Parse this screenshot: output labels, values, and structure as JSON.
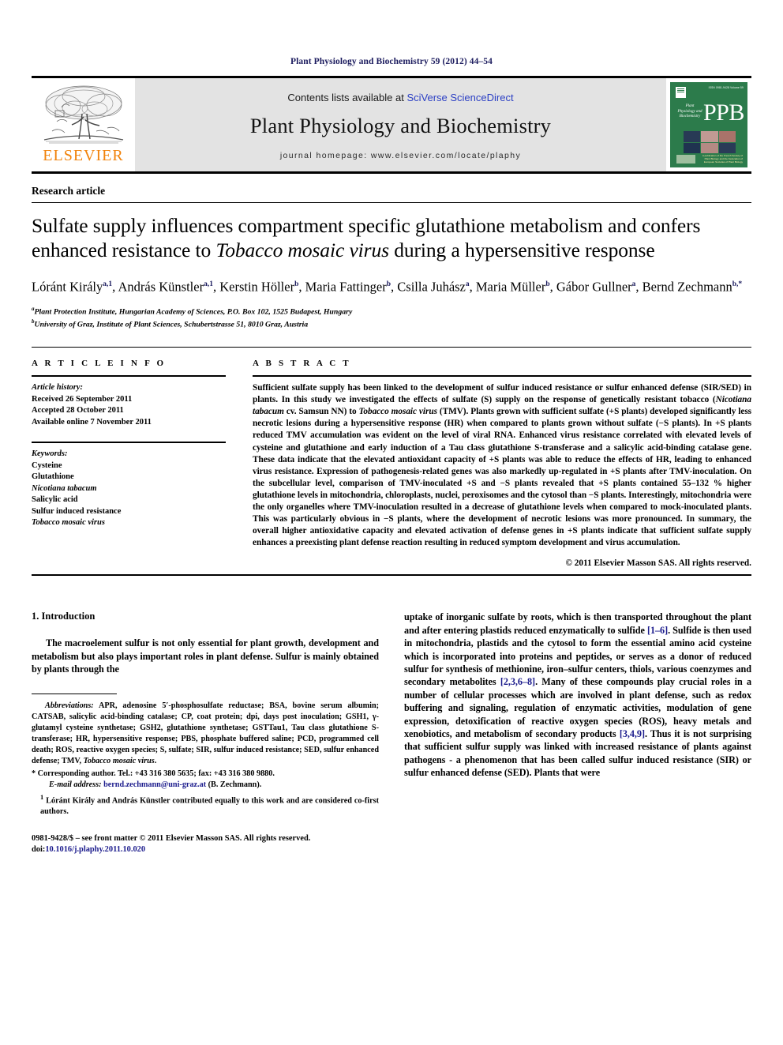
{
  "running_head": "Plant Physiology and Biochemistry 59 (2012) 44–54",
  "banner": {
    "publisher_name": "ELSEVIER",
    "contents_prefix": "Contents lists available at ",
    "contents_link": "SciVerse ScienceDirect",
    "journal_title": "Plant Physiology and Biochemistry",
    "homepage": "journal homepage: www.elsevier.com/locate/plaphy",
    "cover": {
      "mark": "PPB",
      "sub": "Plant Physiology and Biochemistry",
      "issn": "ISSN 0981-9428 Volume 59",
      "footer": "A publication of the French Society of Plant Biology and the Federation of European Societies of Plant Biology"
    },
    "accent_orange": "#f1820a",
    "link_blue": "#2b3fc4",
    "cover_green": "#2c7b4b"
  },
  "article_type": "Research article",
  "title": {
    "part1": "Sulfate supply influences compartment specific glutathione metabolism and confers enhanced resistance to ",
    "italic": "Tobacco mosaic virus",
    "part2": " during a hypersensitive response"
  },
  "authors_line1": "Lóránt Király",
  "authors_html": "Lóránt Király a,1, András Künstler a,1, Kerstin Höller b, Maria Fattinger b, Csilla Juhász a, Maria Müller b, Gábor Gullner a, Bernd Zechmann b,*",
  "affiliations": [
    {
      "mark": "a",
      "text": "Plant Protection Institute, Hungarian Academy of Sciences, P.O. Box 102, 1525 Budapest, Hungary"
    },
    {
      "mark": "b",
      "text": "University of Graz, Institute of Plant Sciences, Schubertstrasse 51, 8010 Graz, Austria"
    }
  ],
  "article_info": {
    "heading": "A R T I C L E    I N F O",
    "history_label": "Article history:",
    "history": [
      "Received 26 September 2011",
      "Accepted 28 October 2011",
      "Available online 7 November 2011"
    ],
    "keywords_label": "Keywords:",
    "keywords": [
      {
        "text": "Cysteine",
        "italic": false
      },
      {
        "text": "Glutathione",
        "italic": false
      },
      {
        "text": "Nicotiana tabacum",
        "italic": true
      },
      {
        "text": "Salicylic acid",
        "italic": false
      },
      {
        "text": "Sulfur induced resistance",
        "italic": false
      },
      {
        "text": "Tobacco mosaic virus",
        "italic": true
      }
    ]
  },
  "abstract": {
    "heading": "A B S T R A C T",
    "copyright": "© 2011 Elsevier Masson SAS. All rights reserved."
  },
  "introduction": {
    "heading": "1. Introduction",
    "left_para": "The macroelement sulfur is not only essential for plant growth, development and metabolism but also plays important roles in plant defense. Sulfur is mainly obtained by plants through the"
  },
  "footnotes": {
    "abbrev_label": "Abbreviations:",
    "abbrev_text": " APR, adenosine 5′-phosphosulfate reductase; BSA, bovine serum albumin; CATSAB, salicylic acid-binding catalase; CP, coat protein; dpi, days post inoculation; GSH1, γ-glutamyl cysteine synthetase; GSH2, glutathione synthetase; GSTTau1, Tau class glutathione S-transferase; HR, hypersensitive response; PBS, phosphate buffered saline; PCD, programmed cell death; ROS, reactive oxygen species; S, sulfate; SIR, sulfur induced resistance; SED, sulfur enhanced defense; TMV, ",
    "abbrev_italic_tail": "Tobacco mosaic virus",
    "abbrev_end": ".",
    "corresponding": "* Corresponding author. Tel.: +43 316 380 5635; fax: +43 316 380 9880.",
    "email_label": "E-mail address:",
    "email": "bernd.zechmann@uni-graz.at",
    "email_suffix": " (B. Zechmann).",
    "equal_contrib": "Lóránt Király and András Künstler contributed equally to this work and are considered co-first authors.",
    "equal_marker": "1"
  },
  "issn_block": {
    "line1": "0981-9428/$ – see front matter © 2011 Elsevier Masson SAS. All rights reserved.",
    "doi_label": "doi:",
    "doi": "10.1016/j.plaphy.2011.10.020"
  }
}
